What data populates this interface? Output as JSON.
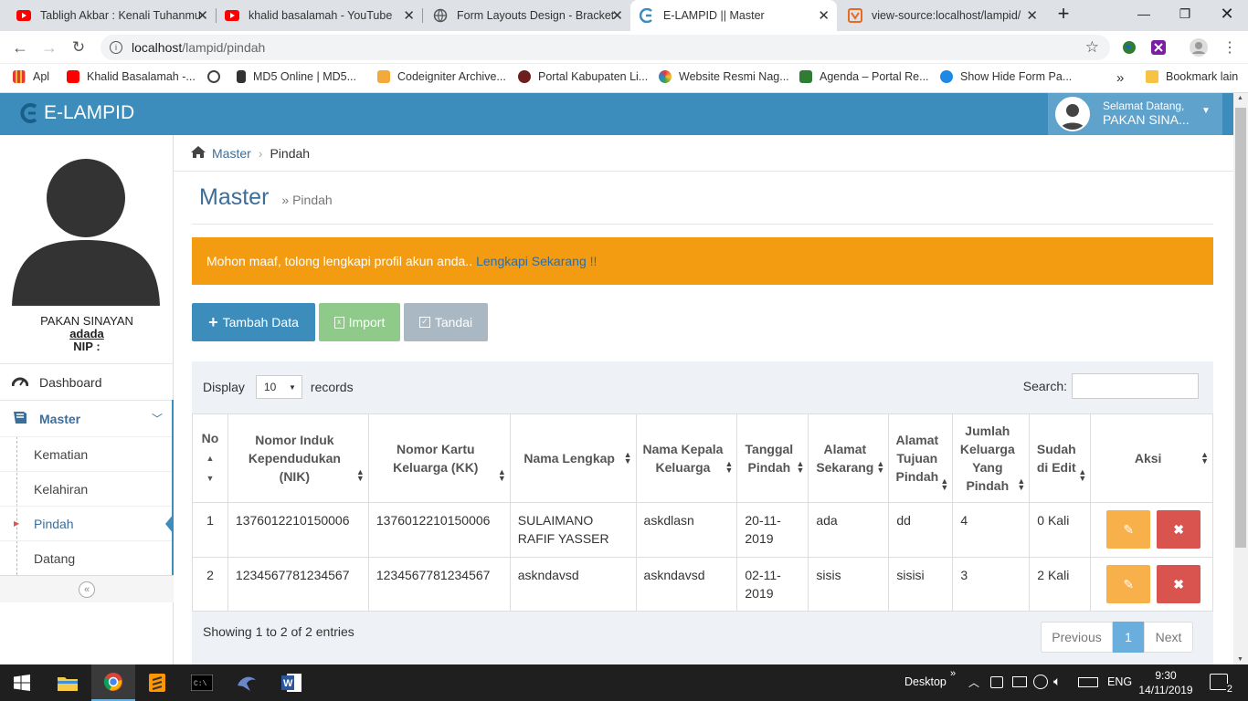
{
  "browser": {
    "tabs": [
      {
        "title": "Tabligh Akbar : Kenali Tuhanmu",
        "icon": "youtube-icon"
      },
      {
        "title": "khalid basalamah - YouTube",
        "icon": "youtube-icon"
      },
      {
        "title": "Form Layouts Design - Bracket",
        "icon": "globe-icon"
      },
      {
        "title": "E-LAMPID || Master",
        "icon": "elampid-icon"
      },
      {
        "title": "view-source:localhost/lampid/",
        "icon": "source-icon"
      }
    ],
    "url_host": "localhost",
    "url_path": "/lampid/pindah",
    "bookmarks": [
      {
        "label": "Apl"
      },
      {
        "label": "Khalid Basalamah -..."
      },
      {
        "label": ""
      },
      {
        "label": "MD5 Online | MD5..."
      },
      {
        "label": "Codeigniter Archive..."
      },
      {
        "label": "Portal Kabupaten Li..."
      },
      {
        "label": "Website Resmi Nag..."
      },
      {
        "label": "Agenda – Portal Re..."
      },
      {
        "label": "Show Hide Form Pa..."
      }
    ],
    "bookmarks_overflow": "»",
    "other_bookmarks": "Bookmark lain"
  },
  "app": {
    "brand": "E-LAMPID",
    "welcome": "Selamat Datang,",
    "username_short": "PAKAN SINA..."
  },
  "sidebar": {
    "user_name": "PAKAN SINAYAN",
    "user_sub": "adada",
    "nip_label": "NIP :",
    "menu": {
      "dashboard": "Dashboard",
      "master": "Master",
      "sub": [
        "Kematian",
        "Kelahiran",
        "Pindah",
        "Datang"
      ]
    }
  },
  "breadcrumb": {
    "home": "Master",
    "current": "Pindah"
  },
  "page": {
    "title": "Master",
    "subtitle": "» Pindah"
  },
  "alert": {
    "text": "Mohon maaf, tolong lengkapi profil akun anda..",
    "link": "Lengkapi Sekarang !!"
  },
  "actions": {
    "add": "Tambah Data",
    "import": "Import",
    "mark": "Tandai"
  },
  "datatable": {
    "display_label": "Display",
    "display_value": "10",
    "records_label": "records",
    "search_label": "Search:",
    "headers": [
      "No",
      "Nomor Induk Kependudukan (NIK)",
      "Nomor Kartu Keluarga (KK)",
      "Nama Lengkap",
      "Nama Kepala Keluarga",
      "Tanggal Pindah",
      "Alamat Sekarang",
      "Alamat Tujuan Pindah",
      "Jumlah Keluarga Yang Pindah",
      "Sudah di Edit",
      "Aksi"
    ],
    "rows": [
      [
        "1",
        "1376012210150006",
        "1376012210150006",
        "SULAIMANO RAFIF YASSER",
        "askdlasn",
        "20-11-2019",
        "ada",
        "dd",
        "4",
        "0 Kali"
      ],
      [
        "2",
        "1234567781234567",
        "1234567781234567",
        "askndavsd",
        "askndavsd",
        "02-11-2019",
        "sisis",
        "sisisi",
        "3",
        "2 Kali"
      ]
    ],
    "info": "Showing 1 to 2 of 2 entries",
    "prev": "Previous",
    "page": "1",
    "next": "Next"
  },
  "taskbar": {
    "desktop": "Desktop",
    "lang": "ENG",
    "time": "9:30",
    "date": "14/11/2019",
    "notif": "2"
  },
  "colors": {
    "primary": "#3c8dbc",
    "alert": "#f39c12",
    "success": "#8fca8a",
    "muted": "#a9b8c2",
    "warning": "#f8b04b",
    "danger": "#d9534f"
  }
}
